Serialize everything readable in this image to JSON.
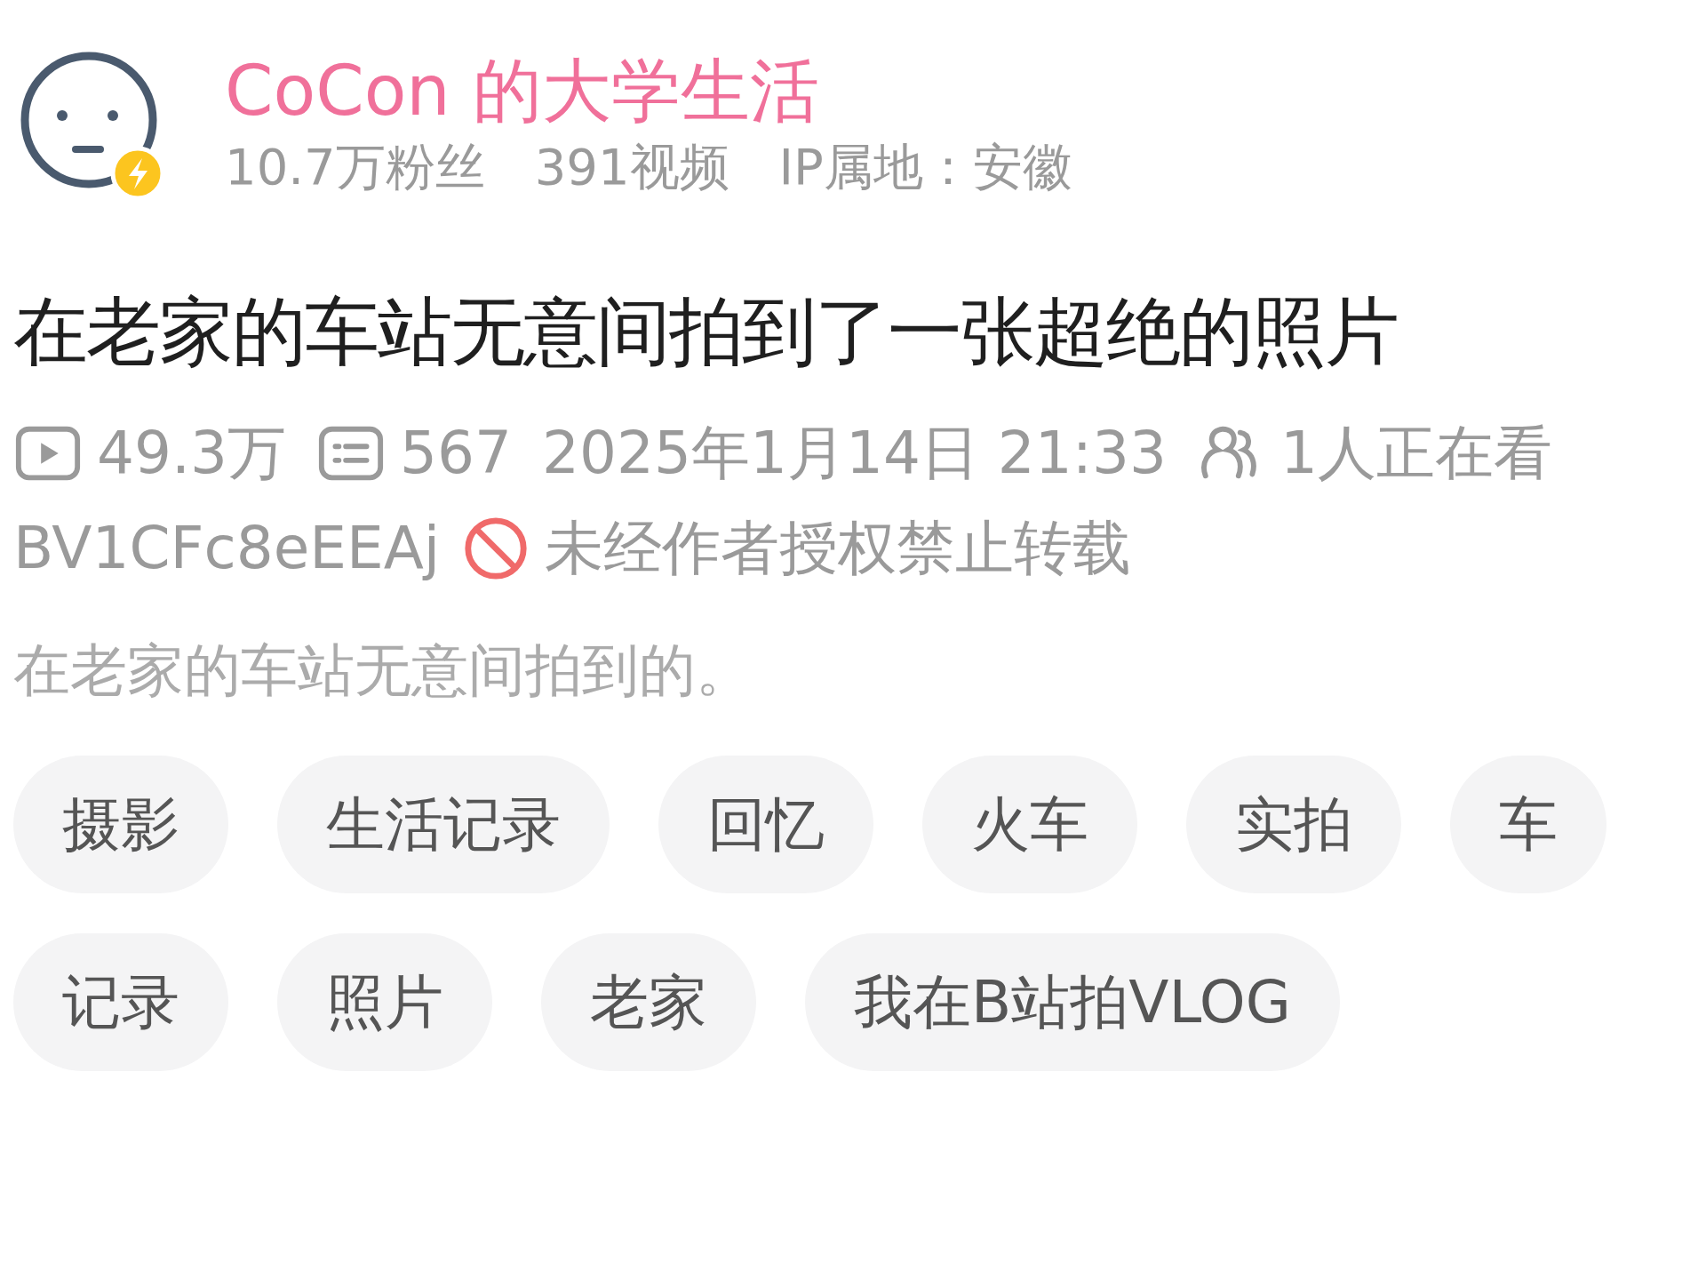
{
  "uploader": {
    "name": "CoCon 的大学生活",
    "stats": [
      "10.7万粉丝",
      "391视频",
      "IP属地：安徽"
    ]
  },
  "video": {
    "title": "在老家的车站无意间拍到了一张超绝的照片",
    "meta": [
      {
        "kind": "views",
        "text": "49.3万"
      },
      {
        "kind": "comments",
        "text": "567"
      },
      {
        "kind": "date",
        "text": "2025年1月14日 21:33"
      },
      {
        "kind": "watching",
        "text": "1人正在看"
      }
    ],
    "bvid": "BV1CFc8eEEAj",
    "copyright": "未经作者授权禁止转载",
    "description": "在老家的车站无意间拍到的。"
  },
  "tag_rows": [
    [
      "摄影",
      "生活记录",
      "回忆",
      "火车",
      "实拍",
      "车"
    ],
    [
      "记录",
      "照片",
      "老家",
      "我在B站拍VLOG"
    ]
  ]
}
